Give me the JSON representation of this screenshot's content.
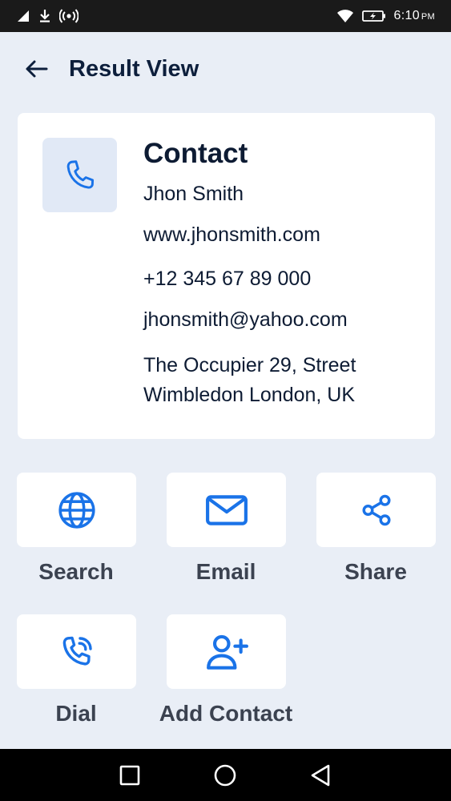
{
  "status_bar": {
    "time": "6:10",
    "ampm": "PM"
  },
  "header": {
    "title": "Result View"
  },
  "card": {
    "title": "Contact",
    "name": "Jhon Smith",
    "website": "www.jhonsmith.com",
    "phone": "+12 345 67 89 000",
    "email": "jhonsmith@yahoo.com",
    "address_line1": "The Occupier 29, Street",
    "address_line2": "Wimbledon London, UK"
  },
  "actions": [
    {
      "label": "Search",
      "icon": "globe-icon"
    },
    {
      "label": "Email",
      "icon": "mail-icon"
    },
    {
      "label": "Share",
      "icon": "share-icon"
    },
    {
      "label": "Dial",
      "icon": "phone-call-icon"
    },
    {
      "label": "Add Contact",
      "icon": "add-user-icon"
    }
  ],
  "colors": {
    "background": "#e9eef6",
    "accent": "#1a73e8",
    "icon_box": "#e1e9f6",
    "text_dark": "#0d1b33",
    "label_gray": "#3b4250"
  }
}
